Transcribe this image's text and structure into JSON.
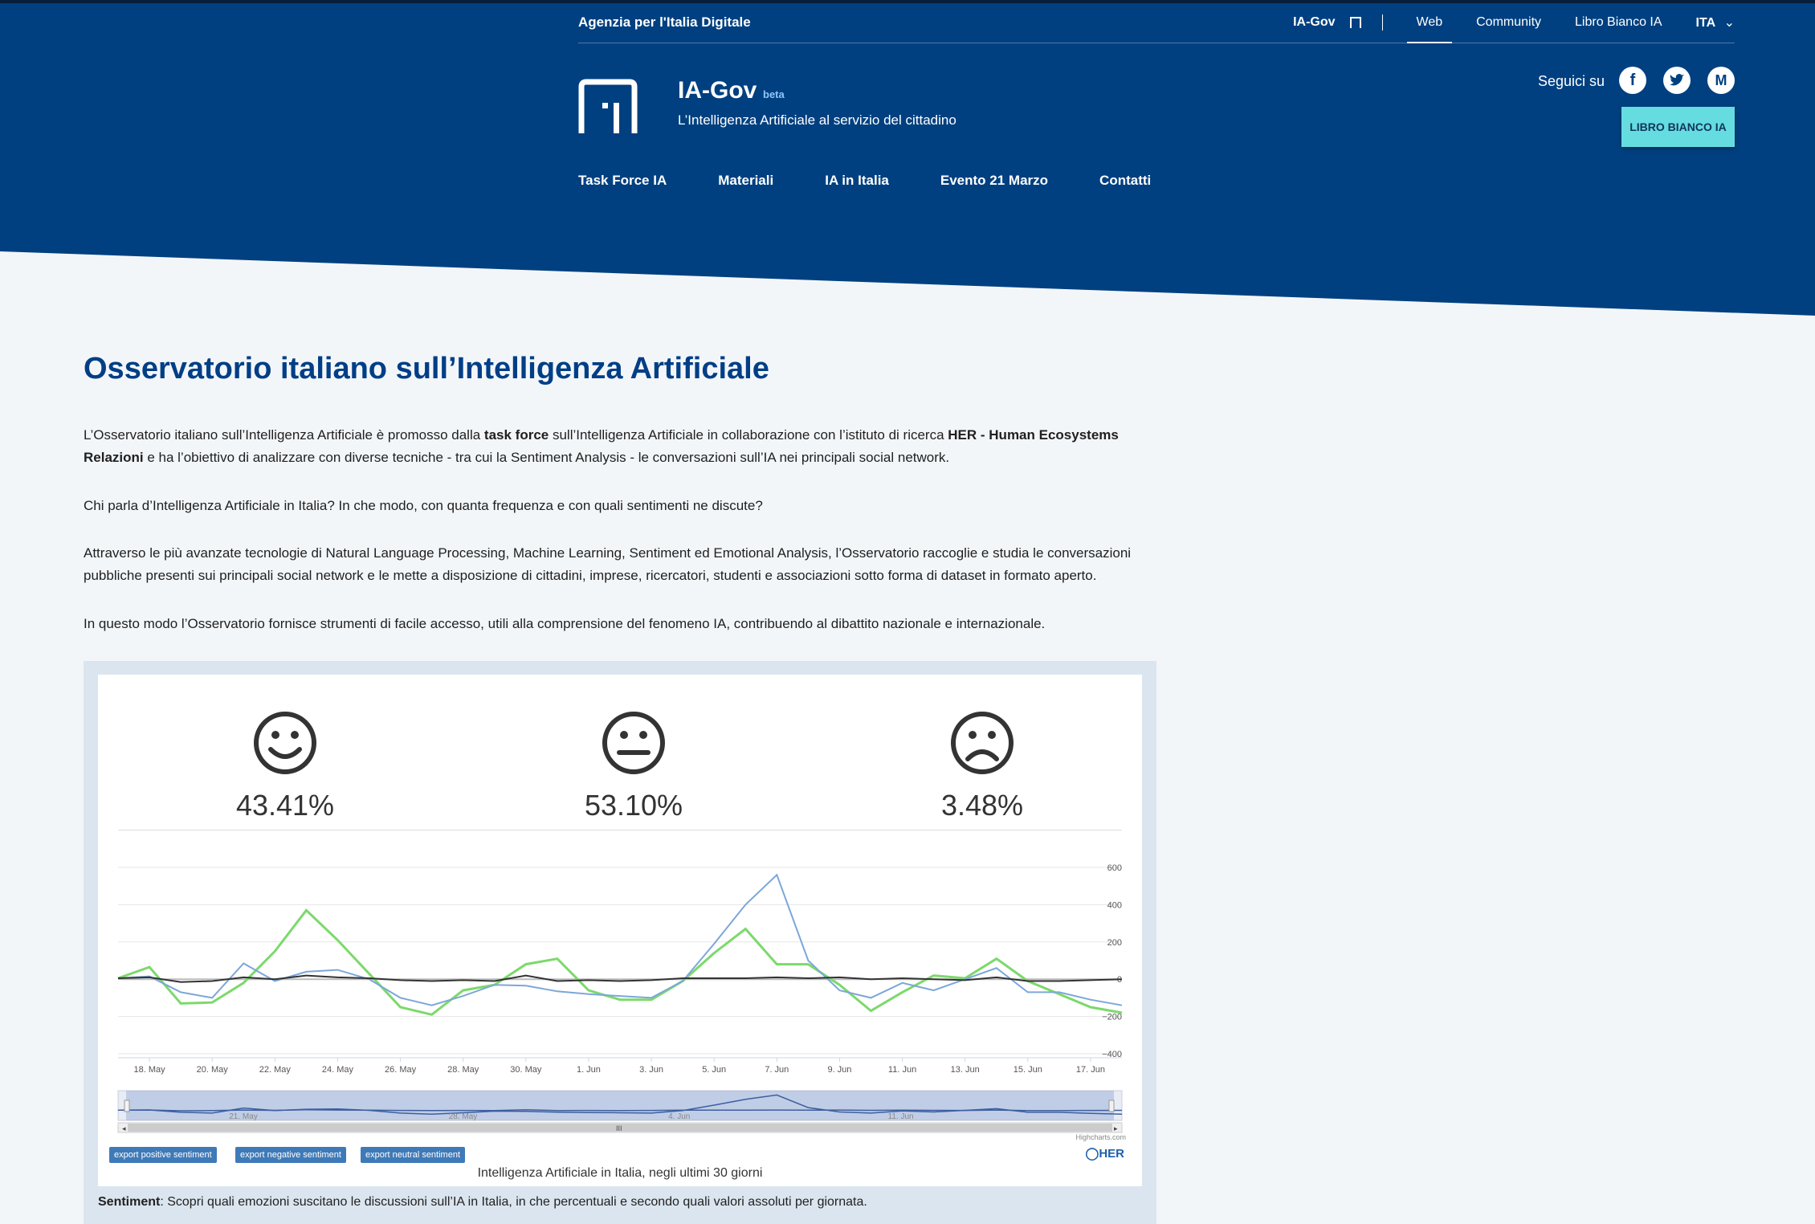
{
  "top_bar": {
    "agency": "Agenzia per l'Italia Digitale",
    "links": [
      "IA-Gov",
      "Web",
      "Community",
      "Libro Bianco IA",
      "ITA"
    ]
  },
  "brand": {
    "title": "IA-Gov",
    "beta": "beta",
    "subtitle": "L’Intelligenza Artificiale al servizio del cittadino"
  },
  "social": {
    "label": "Seguici su",
    "icons": [
      "facebook-icon",
      "twitter-icon",
      "medium-icon"
    ]
  },
  "cta": {
    "label": "LIBRO BIANCO IA"
  },
  "nav": [
    "Task Force IA",
    "Materiali",
    "IA in Italia",
    "Evento 21 Marzo",
    "Contatti"
  ],
  "page": {
    "title": "Osservatorio italiano sull’Intelligenza Artificiale",
    "p1_a": "L’Osservatorio italiano sull’Intelligenza Artificiale è promosso dalla ",
    "p1_b": "task force",
    "p1_c": " sull’Intelligenza Artificiale in collaborazione con l’istituto di ricerca ",
    "p1_d": "HER - Human Ecosystems Relazioni",
    "p1_e": " e ha l’obiettivo di analizzare con diverse tecniche - tra cui la Sentiment Analysis - le conversazioni sull’IA nei principali social network.",
    "p2": "Chi parla d’Intelligenza Artificiale in Italia? In che modo, con quanta frequenza e con quali sentimenti ne discute?",
    "p3": "Attraverso le più avanzate tecnologie di Natural Language Processing, Machine Learning, Sentiment ed Emotional Analysis, l’Osservatorio raccoglie e studia le conversazioni pubbliche presenti sui principali social network e le mette a disposizione di cittadini, imprese, ricercatori, studenti e associazioni sotto forma di dataset in formato aperto.",
    "p4": "In questo modo l’Osservatorio fornisce strumenti di facile accesso, utili alla comprensione del fenomeno IA, contribuendo al dibattito nazionale e internazionale."
  },
  "sentiment": {
    "positive": "43.41%",
    "neutral": "53.10%",
    "negative": "3.48%"
  },
  "exports": [
    "export positive sentiment",
    "export negative sentiment",
    "export neutral sentiment"
  ],
  "credits": {
    "highcharts": "Highcharts.com",
    "her": "HER"
  },
  "caption": {
    "label": "Sentiment",
    "text": ": Scopri quali emozioni suscitano le discussioni sull’IA in Italia, in che percentuali e secondo quali valori assoluti per giornata."
  },
  "chart_data": {
    "type": "line",
    "title": "Intelligenza Artificiale in Italia, negli ultimi 30 giorni",
    "x_ticks": [
      "18. May",
      "20. May",
      "22. May",
      "24. May",
      "26. May",
      "28. May",
      "30. May",
      "1. Jun",
      "3. Jun",
      "5. Jun",
      "7. Jun",
      "9. Jun",
      "11. Jun",
      "13. Jun",
      "15. Jun",
      "17. Jun"
    ],
    "y_ticks": [
      600,
      400,
      200,
      0,
      -200,
      -400
    ],
    "ylim": [
      -400,
      600
    ],
    "navigator_labels": [
      "21. May",
      "28. May",
      "4. Jun",
      "11. Jun"
    ],
    "x": [
      "17. May",
      "18. May",
      "19. May",
      "20. May",
      "21. May",
      "22. May",
      "23. May",
      "24. May",
      "25. May",
      "26. May",
      "27. May",
      "28. May",
      "29. May",
      "30. May",
      "31. May",
      "1. Jun",
      "2. Jun",
      "3. Jun",
      "4. Jun",
      "5. Jun",
      "6. Jun",
      "7. Jun",
      "8. Jun",
      "9. Jun",
      "10. Jun",
      "11. Jun",
      "12. Jun",
      "13. Jun",
      "14. Jun",
      "15. Jun",
      "16. Jun",
      "17. Jun",
      "18. Jun"
    ],
    "series": [
      {
        "color": "#7cd96b",
        "values": [
          5,
          65,
          -130,
          -125,
          -20,
          150,
          370,
          210,
          30,
          -150,
          -190,
          -60,
          -30,
          80,
          110,
          -60,
          -110,
          -110,
          -10,
          140,
          270,
          80,
          80,
          -30,
          -170,
          -70,
          20,
          5,
          110,
          -10,
          -80,
          -150,
          -180
        ]
      },
      {
        "color": "#7ca7d9",
        "values": [
          5,
          15,
          -70,
          -100,
          85,
          -10,
          40,
          50,
          0,
          -100,
          -140,
          -90,
          -30,
          -35,
          -65,
          -80,
          -90,
          -100,
          -10,
          190,
          400,
          560,
          100,
          -60,
          -100,
          -20,
          -60,
          0,
          60,
          -70,
          -70,
          -110,
          -140
        ]
      },
      {
        "color": "#333333",
        "values": [
          5,
          10,
          -15,
          -10,
          10,
          0,
          20,
          10,
          5,
          -5,
          -10,
          -5,
          -10,
          20,
          -10,
          -5,
          -10,
          -5,
          5,
          5,
          5,
          10,
          5,
          10,
          0,
          5,
          0,
          -5,
          10,
          -10,
          -10,
          -5,
          0
        ]
      },
      {
        "color": "#bbbbbb",
        "values": [
          0,
          0,
          0,
          0,
          0,
          0,
          0,
          0,
          0,
          0,
          0,
          0,
          0,
          0,
          0,
          0,
          0,
          0,
          0,
          0,
          0,
          0,
          0,
          0,
          0,
          0,
          0,
          0,
          0,
          0,
          0,
          0,
          0
        ]
      }
    ]
  }
}
